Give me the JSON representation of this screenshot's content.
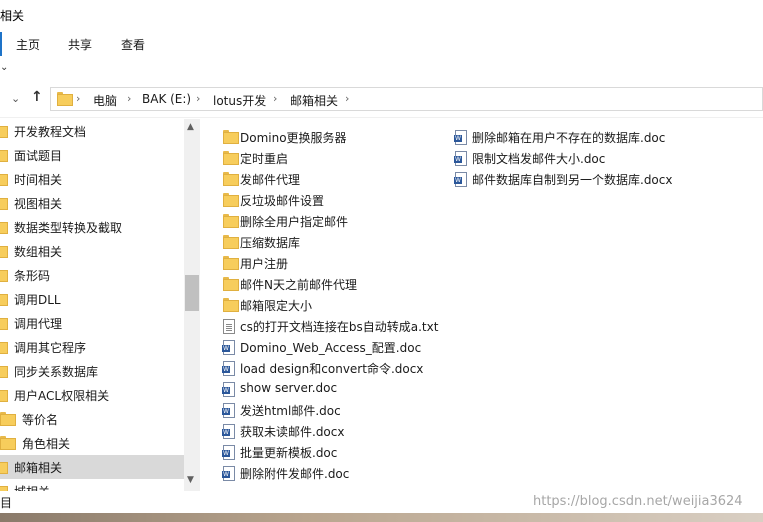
{
  "window": {
    "title": "相关"
  },
  "ribbon": {
    "tabs": [
      "主页",
      "共享",
      "查看"
    ]
  },
  "ribbon_collapse_glyph": "⌄",
  "address": {
    "segments": [
      "电脑",
      "BAK (E:)",
      "lotus开发",
      "邮箱相关"
    ]
  },
  "nav_items": [
    {
      "label": "开发教程文档"
    },
    {
      "label": "面试题目"
    },
    {
      "label": "时间相关"
    },
    {
      "label": "视图相关"
    },
    {
      "label": "数据类型转换及截取"
    },
    {
      "label": "数组相关"
    },
    {
      "label": "条形码"
    },
    {
      "label": "调用DLL"
    },
    {
      "label": "调用代理"
    },
    {
      "label": "调用其它程序"
    },
    {
      "label": "同步关系数据库"
    },
    {
      "label": "用户ACL权限相关"
    },
    {
      "label": "等价名"
    },
    {
      "label": "角色相关"
    },
    {
      "label": "邮箱相关",
      "selected": true
    },
    {
      "label": "城相关"
    }
  ],
  "files_col1": [
    {
      "type": "folder",
      "name": "Domino更换服务器"
    },
    {
      "type": "folder",
      "name": "定时重启"
    },
    {
      "type": "folder",
      "name": "发邮件代理"
    },
    {
      "type": "folder",
      "name": "反垃圾邮件设置"
    },
    {
      "type": "folder",
      "name": "删除全用户指定邮件"
    },
    {
      "type": "folder",
      "name": "压缩数据库"
    },
    {
      "type": "folder",
      "name": "用户注册"
    },
    {
      "type": "folder",
      "name": "邮件N天之前邮件代理"
    },
    {
      "type": "folder",
      "name": "邮箱限定大小"
    },
    {
      "type": "txt",
      "name": "cs的打开文档连接在bs自动转成a.txt"
    },
    {
      "type": "doc",
      "name": "Domino_Web_Access_配置.doc"
    },
    {
      "type": "doc",
      "name": "load design和convert命令.docx"
    },
    {
      "type": "doc",
      "name": "show server.doc"
    },
    {
      "type": "doc",
      "name": "发送html邮件.doc"
    },
    {
      "type": "doc",
      "name": "获取未读邮件.docx"
    },
    {
      "type": "doc",
      "name": "批量更新模板.doc"
    },
    {
      "type": "doc",
      "name": "删除附件发邮件.doc"
    }
  ],
  "files_col2": [
    {
      "type": "doc",
      "name": "删除邮箱在用户不存在的数据库.doc"
    },
    {
      "type": "doc",
      "name": "限制文档发邮件大小.doc"
    },
    {
      "type": "doc",
      "name": "邮件数据库自制到另一个数据库.docx"
    }
  ],
  "status": {
    "items_label": "目"
  },
  "watermark": "https://blog.csdn.net/weijia3624"
}
